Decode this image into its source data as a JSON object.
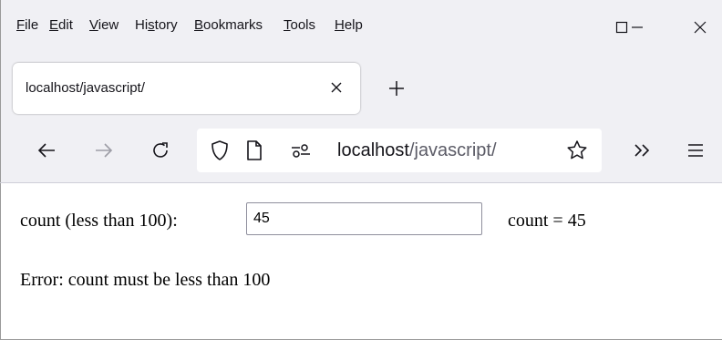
{
  "menubar": {
    "items": [
      {
        "accel": "F",
        "rest": "ile"
      },
      {
        "accel": "E",
        "rest": "dit"
      },
      {
        "accel": "V",
        "rest": "iew"
      },
      {
        "pre": "Hi",
        "accel": "s",
        "rest": "tory"
      },
      {
        "accel": "B",
        "rest": "ookmarks"
      },
      {
        "accel": "T",
        "rest": "ools"
      },
      {
        "accel": "H",
        "rest": "elp"
      }
    ]
  },
  "window_controls": [
    "minimize-icon",
    "maximize-icon",
    "close-icon"
  ],
  "tab": {
    "title": "localhost/javascript/"
  },
  "url": {
    "host": "localhost",
    "path": "/javascript/"
  },
  "toolbar_icons": [
    "back-icon",
    "forward-icon",
    "reload-icon",
    "shield-icon",
    "page-icon",
    "permissions-icon",
    "bookmark-star-icon",
    "overflow-chevrons-icon",
    "hamburger-menu-icon"
  ],
  "page": {
    "count_label": "count (less than 100):",
    "count_value": "45",
    "count_display": "count = 45",
    "error_message": "Error: count must be less than 100"
  }
}
